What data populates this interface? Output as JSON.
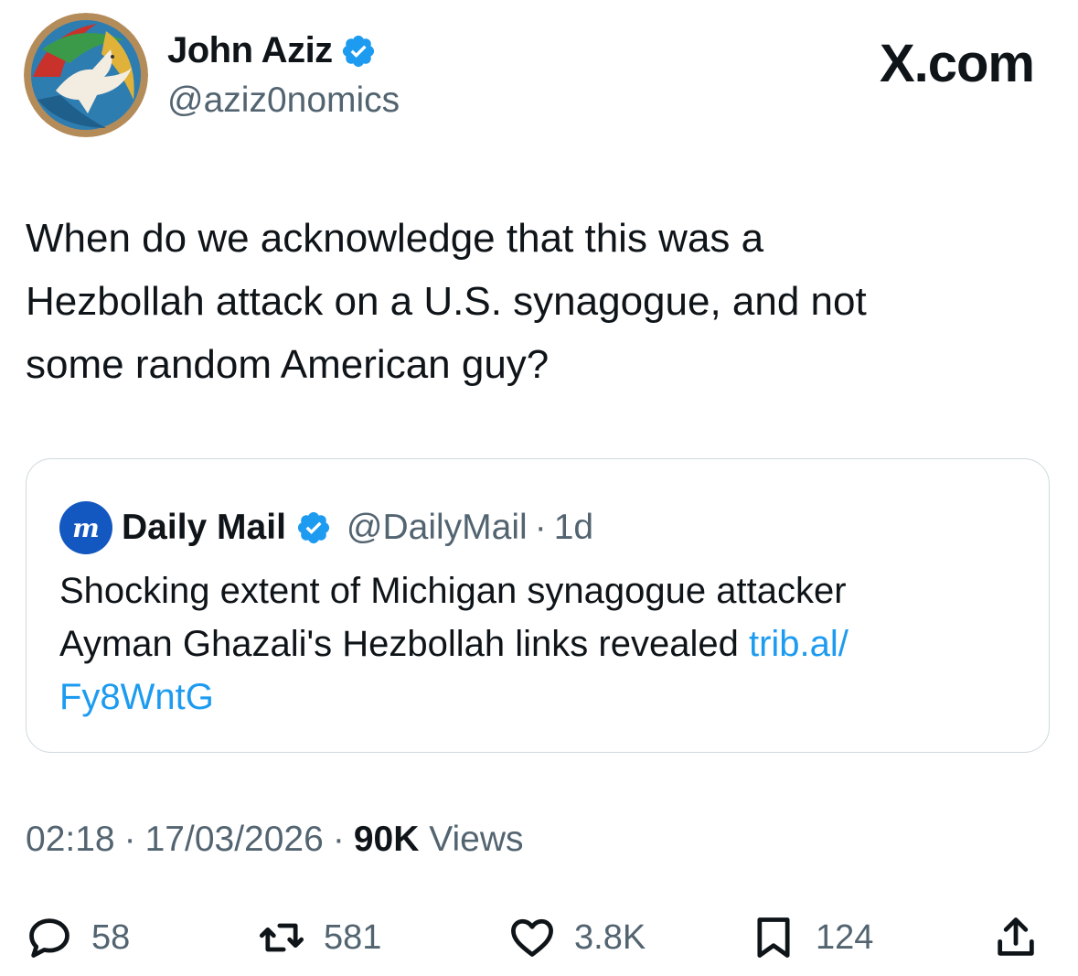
{
  "author": {
    "name": "John Aziz",
    "handle": "@aziz0nomics",
    "verified_color": "#1d9bf0"
  },
  "brand": "X.com",
  "tweet": {
    "lines": [
      "When do we acknowledge that this was a",
      "Hezbollah attack on a U.S. synagogue, and not",
      "some random American guy?"
    ]
  },
  "quoted": {
    "logo_text": "m",
    "name": "Daily Mail",
    "handle": "@DailyMail",
    "separator": "·",
    "age": "1d",
    "text_lines": [
      "Shocking extent of Michigan synagogue attacker",
      "Ayman Ghazali's Hezbollah links revealed"
    ],
    "link_part1": "trib.al/",
    "link_part2": "Fy8WntG",
    "link_color": "#1d9bf0"
  },
  "meta": {
    "time": "02:18",
    "sep": "·",
    "date": "17/03/2026",
    "views_count": "90K",
    "views_label": "Views"
  },
  "actions": {
    "replies": "58",
    "reposts": "581",
    "likes": "3.8K",
    "bookmarks": "124"
  },
  "icons": [
    "verified-badge-icon",
    "reply-icon",
    "repost-icon",
    "like-icon",
    "bookmark-icon",
    "share-icon"
  ]
}
